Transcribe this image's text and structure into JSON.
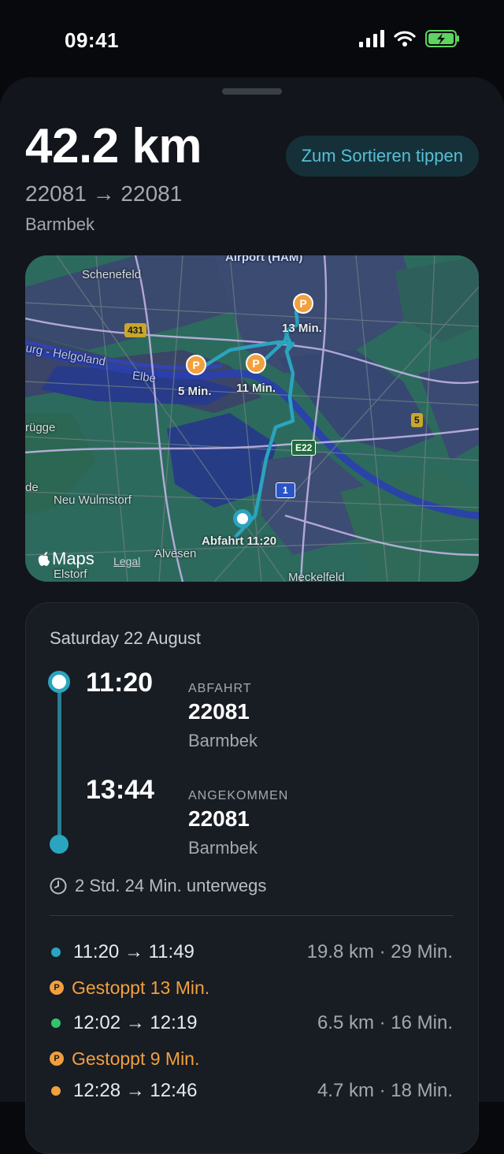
{
  "status_bar": {
    "time": "09:41"
  },
  "trip": {
    "distance": "42.2 km",
    "route_codes": "22081 → 22081",
    "area": "Barmbek",
    "sort_button": "Zum Sortieren tippen"
  },
  "map": {
    "labels": {
      "airport": "Airport (HAM)",
      "schenefeld": "Schenefeld",
      "elbe": "Elbe",
      "helgoland": "urg - Helgoland",
      "rugge": "rügge",
      "de": "de",
      "neu_wulmstorf": "Neu Wulmstorf",
      "alvesen": "Alvesen",
      "elstorf": "Elstorf",
      "meckelfeld": "Meckelfeld",
      "stop_13": "13 Min.",
      "stop_5": "5 Min.",
      "stop_11": "11 Min.",
      "departure": "Abfahrt 11:20",
      "maps_brand": "Maps",
      "legal": "Legal"
    },
    "shields": {
      "r431": "431",
      "r5": "5",
      "e22": "E22",
      "a1": "1"
    },
    "pin_letter": "P",
    "colors": {
      "route": "#2aa4bf",
      "stop": "#f2a03d"
    }
  },
  "detail": {
    "date": "Saturday 22 August",
    "departure": {
      "time": "11:20",
      "kind": "ABFAHRT",
      "code": "22081",
      "area": "Barmbek"
    },
    "arrival": {
      "time": "13:44",
      "kind": "ANGEKOMMEN",
      "code": "22081",
      "area": "Barmbek"
    },
    "duration": "2 Std. 24 Min. unterwegs",
    "segments": [
      {
        "time": "11:20 → 11:49",
        "meta": "19.8 km · 29 Min.",
        "color": "#2aa4bf"
      },
      {
        "time": "12:02 → 12:19",
        "meta": "6.5 km · 16 Min.",
        "color": "#34c26b"
      },
      {
        "time": "12:28 → 12:46",
        "meta": "4.7 km · 18 Min.",
        "color": "#f2a03d"
      }
    ],
    "stops": [
      {
        "label": "Gestoppt 13 Min.",
        "badge": "P"
      },
      {
        "label": "Gestoppt 9 Min.",
        "badge": "P"
      }
    ]
  }
}
